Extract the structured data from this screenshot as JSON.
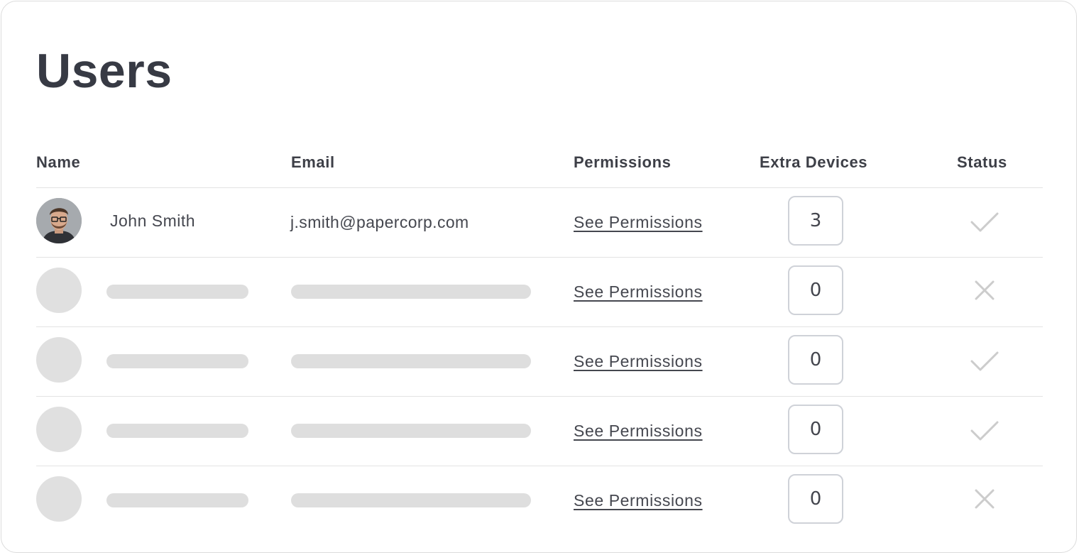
{
  "page": {
    "title": "Users"
  },
  "columns": {
    "name": "Name",
    "email": "Email",
    "permissions": "Permissions",
    "extra_devices": "Extra Devices",
    "status": "Status"
  },
  "rows": [
    {
      "name": "John Smith",
      "email": "j.smith@papercorp.com",
      "permissions_link": "See Permissions",
      "extra_devices": "3",
      "status": "check-icon",
      "loaded": true
    },
    {
      "name": "",
      "email": "",
      "permissions_link": "See Permissions",
      "extra_devices": "0",
      "status": "x-icon",
      "loaded": false
    },
    {
      "name": "",
      "email": "",
      "permissions_link": "See Permissions",
      "extra_devices": "0",
      "status": "check-icon",
      "loaded": false
    },
    {
      "name": "",
      "email": "",
      "permissions_link": "See Permissions",
      "extra_devices": "0",
      "status": "check-icon",
      "loaded": false
    },
    {
      "name": "",
      "email": "",
      "permissions_link": "See Permissions",
      "extra_devices": "0",
      "status": "x-icon",
      "loaded": false
    }
  ],
  "colors": {
    "title": "#373a44",
    "text": "#45474f",
    "skeleton": "#dedede",
    "status_icon": "#cccccc",
    "divider": "#e3e3e3"
  }
}
